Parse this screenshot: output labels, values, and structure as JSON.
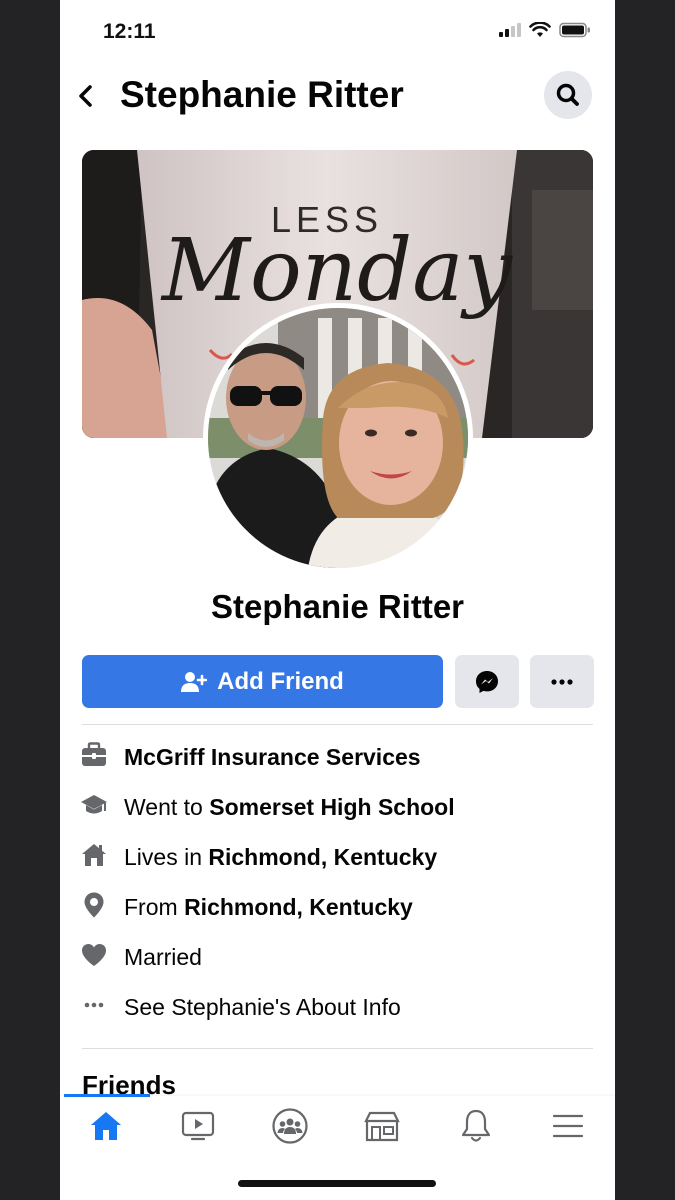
{
  "status_bar": {
    "time": "12:11"
  },
  "header": {
    "title": "Stephanie Ritter"
  },
  "cover": {
    "text_top": "LESS",
    "text_script": "Monday"
  },
  "profile": {
    "name": "Stephanie Ritter",
    "add_friend_label": "Add Friend"
  },
  "about": {
    "work": {
      "text": "McGriff Insurance  Services"
    },
    "education": {
      "prefix": "Went to ",
      "value": "Somerset High School"
    },
    "lives": {
      "prefix": "Lives in ",
      "value": "Richmond, Kentucky"
    },
    "from": {
      "prefix": "From ",
      "value": "Richmond, Kentucky"
    },
    "relationship": {
      "text": "Married"
    },
    "see_about": {
      "text": "See Stephanie's About Info"
    }
  },
  "sections": {
    "friends_title": "Friends"
  },
  "tabs": [
    {
      "icon": "home-icon",
      "active": true
    },
    {
      "icon": "watch-icon",
      "active": false
    },
    {
      "icon": "groups-icon",
      "active": false
    },
    {
      "icon": "marketplace-icon",
      "active": false
    },
    {
      "icon": "bell-icon",
      "active": false
    },
    {
      "icon": "menu-icon",
      "active": false
    }
  ],
  "colors": {
    "accent": "#1877f2",
    "button_primary": "#3578e5",
    "button_secondary": "#e4e6eb"
  }
}
